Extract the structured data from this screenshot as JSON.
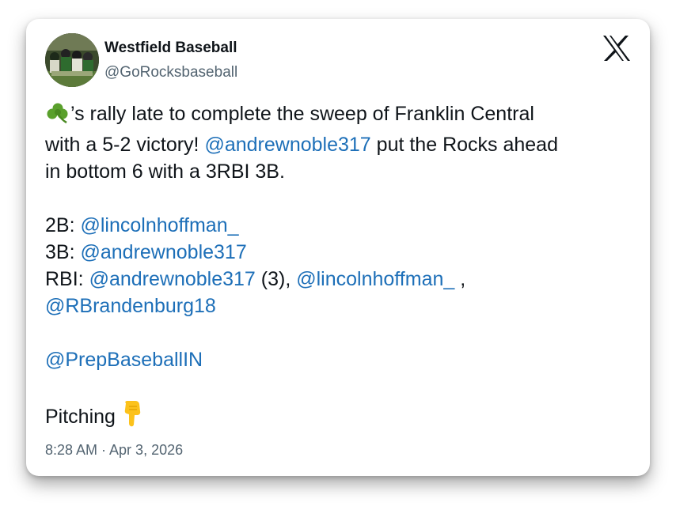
{
  "author": {
    "name": "Westfield Baseball",
    "handle": "@GoRocksbaseball"
  },
  "tweet": {
    "intro_1": "’s rally late to complete the sweep of Franklin Central",
    "intro_2a": "with a 5-2 victory! ",
    "intro_2_mention": "@andrewnoble317",
    "intro_2b": " put the Rocks ahead",
    "intro_3": "in bottom 6 with a 3RBI 3B.",
    "doubles_label": "2B: ",
    "doubles_mention": "@lincolnhoffman_",
    "triples_label": "3B: ",
    "triples_mention": "@andrewnoble317",
    "rbi_label": "RBI: ",
    "rbi_mention_1": "@andrewnoble317",
    "rbi_mid": " (3), ",
    "rbi_mention_2": "@lincolnhoffman_",
    "rbi_end": " ,",
    "rbi_mention_3": "@RBrandenburg18",
    "tag_mention": "@PrepBaseballIN",
    "pitching_label": "Pitching "
  },
  "timestamp": "8:28 AM · Apr 3, 2026",
  "icons": {
    "logo": "x-logo-icon",
    "shamrock": "shamrock-emoji",
    "pointing": "backhand-index-pointing-down-emoji"
  },
  "colors": {
    "mention": "#1d6fb8",
    "text": "#0f1419",
    "secondary": "#536471"
  }
}
